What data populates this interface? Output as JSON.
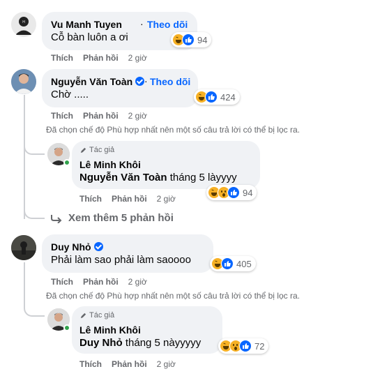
{
  "colors": {
    "accent": "#0866ff",
    "bubble": "#f0f2f5",
    "muted": "#65676b",
    "online": "#31a24c"
  },
  "actions": {
    "like": "Thích",
    "reply": "Phản hồi"
  },
  "comments": [
    {
      "name": "Vu Manh Tuyen",
      "follow": "Theo dõi",
      "text": "Cỗ bàn luôn a ơi",
      "reactions": [
        "haha-icon",
        "like-icon"
      ],
      "count": "94",
      "time": "2 giờ"
    },
    {
      "name": "Nguyễn Văn Toàn",
      "verified": true,
      "follow": "Theo dõi",
      "text": "Chờ .....",
      "reactions": [
        "haha-icon",
        "like-icon"
      ],
      "count": "424",
      "time": "2 giờ",
      "filter_notice": "Đã chọn chế độ Phù hợp nhất nên một số câu trả lời có thể bị lọc ra.",
      "reply": {
        "author_badge": "Tác giả",
        "name": "Lê Minh Khôi",
        "mention": "Nguyễn Văn Toàn",
        "text": "tháng 5 làyyyy",
        "reactions": [
          "haha-icon",
          "wow-icon",
          "like-icon"
        ],
        "count": "94",
        "time": "2 giờ"
      },
      "see_more": "Xem thêm 5 phản hồi"
    },
    {
      "name": "Duy Nhỏ",
      "verified": true,
      "text": "Phải làm sao phải làm saoooo",
      "reactions": [
        "haha-icon",
        "like-icon"
      ],
      "count": "405",
      "time": "2 giờ",
      "filter_notice": "Đã chọn chế độ Phù hợp nhất nên một số câu trả lời có thể bị lọc ra.",
      "reply": {
        "author_badge": "Tác giả",
        "name": "Lê Minh Khôi",
        "mention": "Duy Nhỏ",
        "text": "tháng 5 nàyyyyy",
        "reactions": [
          "haha-icon",
          "wow-icon",
          "like-icon"
        ],
        "count": "72",
        "time": "2 giờ"
      }
    }
  ]
}
